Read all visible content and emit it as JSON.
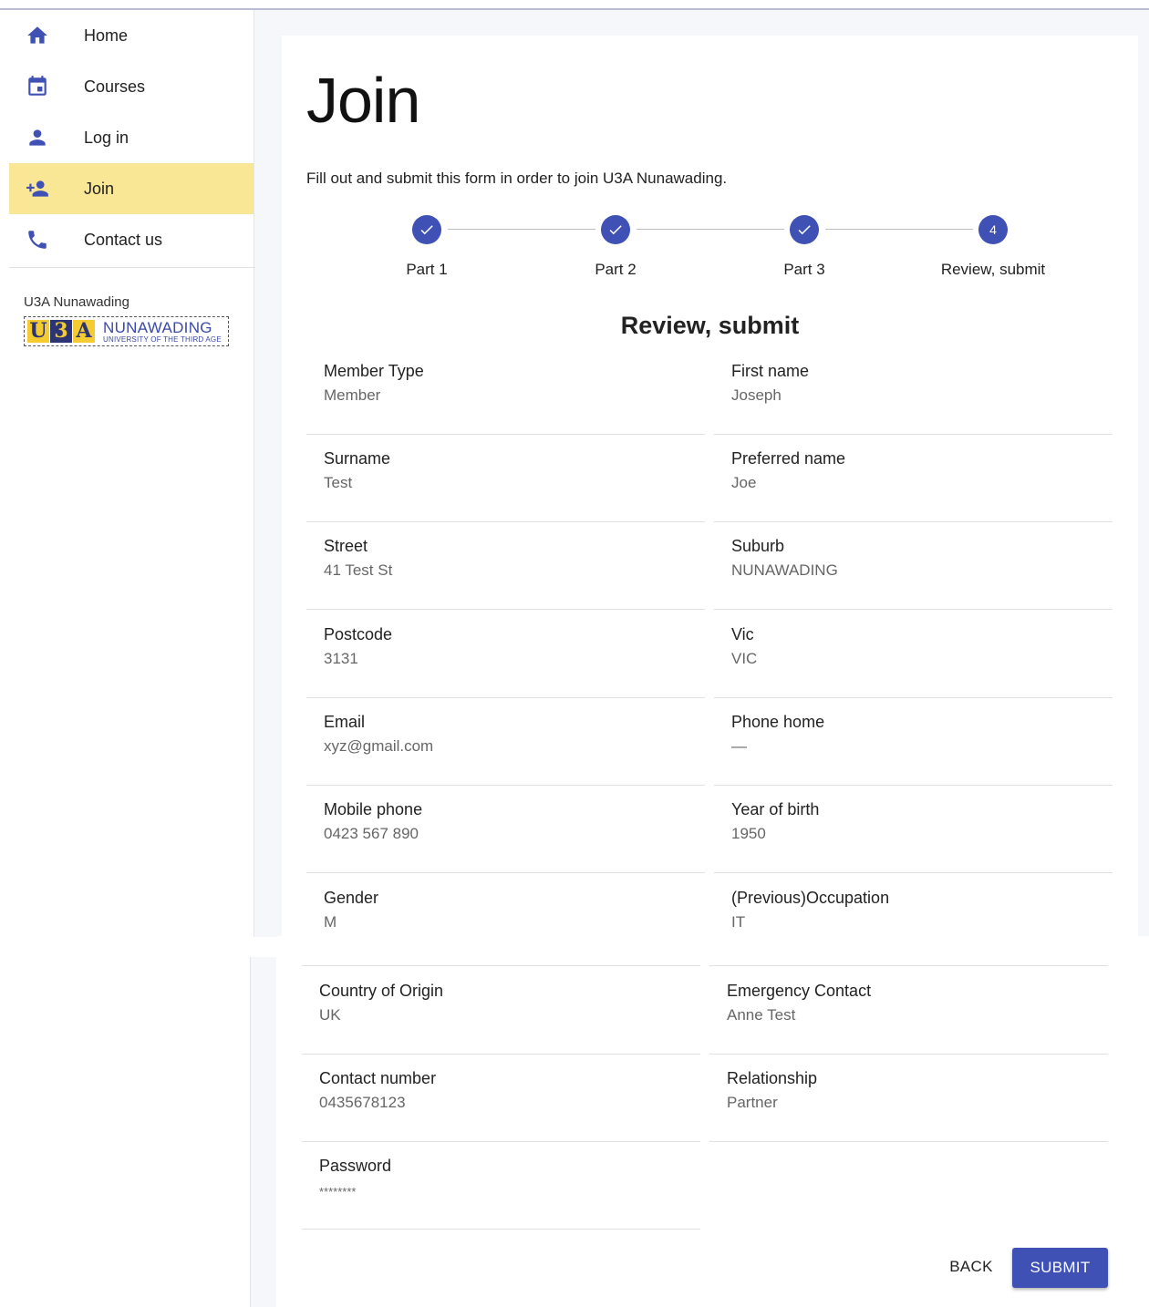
{
  "nav": {
    "items": [
      {
        "label": "Home",
        "icon": "home-icon"
      },
      {
        "label": "Courses",
        "icon": "calendar-icon"
      },
      {
        "label": "Log in",
        "icon": "person-icon"
      },
      {
        "label": "Join",
        "icon": "person-add-icon",
        "active": true
      },
      {
        "label": "Contact us",
        "icon": "phone-icon"
      }
    ],
    "org_name": "U3A Nunawading",
    "logo": {
      "letters": [
        "U",
        "3",
        "A"
      ],
      "title": "NUNAWADING",
      "subtitle": "UNIVERSITY OF THE THIRD AGE"
    }
  },
  "page": {
    "title": "Join",
    "intro": "Fill out and submit this form in order to join U3A Nunawading."
  },
  "stepper": {
    "steps": [
      {
        "label": "Part 1",
        "state": "done"
      },
      {
        "label": "Part 2",
        "state": "done"
      },
      {
        "label": "Part 3",
        "state": "done"
      },
      {
        "label": "Review, submit",
        "state": "active",
        "number": "4"
      }
    ]
  },
  "review": {
    "title": "Review, submit",
    "fields": [
      {
        "label": "Member Type",
        "value": "Member"
      },
      {
        "label": "First name",
        "value": "Joseph"
      },
      {
        "label": "Surname",
        "value": "Test"
      },
      {
        "label": "Preferred name",
        "value": "Joe"
      },
      {
        "label": "Street",
        "value": "41 Test St"
      },
      {
        "label": "Suburb",
        "value": "NUNAWADING"
      },
      {
        "label": "Postcode",
        "value": "3131"
      },
      {
        "label": "Vic",
        "value": "VIC"
      },
      {
        "label": "Email",
        "value": "xyz@gmail.com"
      },
      {
        "label": "Phone home",
        "value": "—"
      },
      {
        "label": "Mobile phone",
        "value": "0423 567 890"
      },
      {
        "label": "Year of birth",
        "value": "1950"
      },
      {
        "label": "Gender",
        "value": "M"
      },
      {
        "label": "(Previous)Occupation",
        "value": "IT"
      },
      {
        "label": "Country of Origin",
        "value": "UK"
      },
      {
        "label": "Emergency Contact",
        "value": "Anne Test"
      },
      {
        "label": "Contact number",
        "value": "0435678123"
      },
      {
        "label": "Relationship",
        "value": "Partner"
      },
      {
        "label": "Password",
        "value": "********"
      }
    ]
  },
  "actions": {
    "back": "BACK",
    "submit": "SUBMIT"
  },
  "colors": {
    "primary": "#3f51b5",
    "active_nav": "#f9e795",
    "background": "#f6f7fb"
  }
}
